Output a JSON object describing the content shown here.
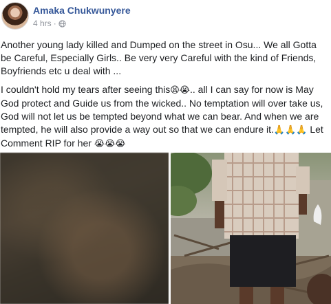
{
  "post": {
    "author": "Amaka Chukwunyere",
    "time": "4 hrs",
    "separator": "·",
    "privacy_icon": "globe-icon",
    "paragraph1": "Another young lady killed and Dumped on the street in Osu... We all Gotta be Careful, Especially Girls.. Be very very Careful with the kind of Friends, Boyfriends etc u deal with ...",
    "paragraph2_part1": "I couldn't hold my tears after seeing this",
    "paragraph2_emoji1": "😫😭",
    "paragraph2_part2": ".. all I can say for now is May God protect and Guide us from the wicked.. No temptation will over take us, God will not let us be tempted beyond what we can bear. And when we are tempted, he will also provide a way out so that we can endure it.",
    "paragraph2_emoji2": "🙏🙏🙏",
    "paragraph2_part3": " Let Comment RIP for her ",
    "paragraph2_emoji3": "😭😭😭"
  },
  "colors": {
    "author_link": "#365899",
    "meta_text": "#90949c",
    "body_text": "#1c1e21"
  }
}
